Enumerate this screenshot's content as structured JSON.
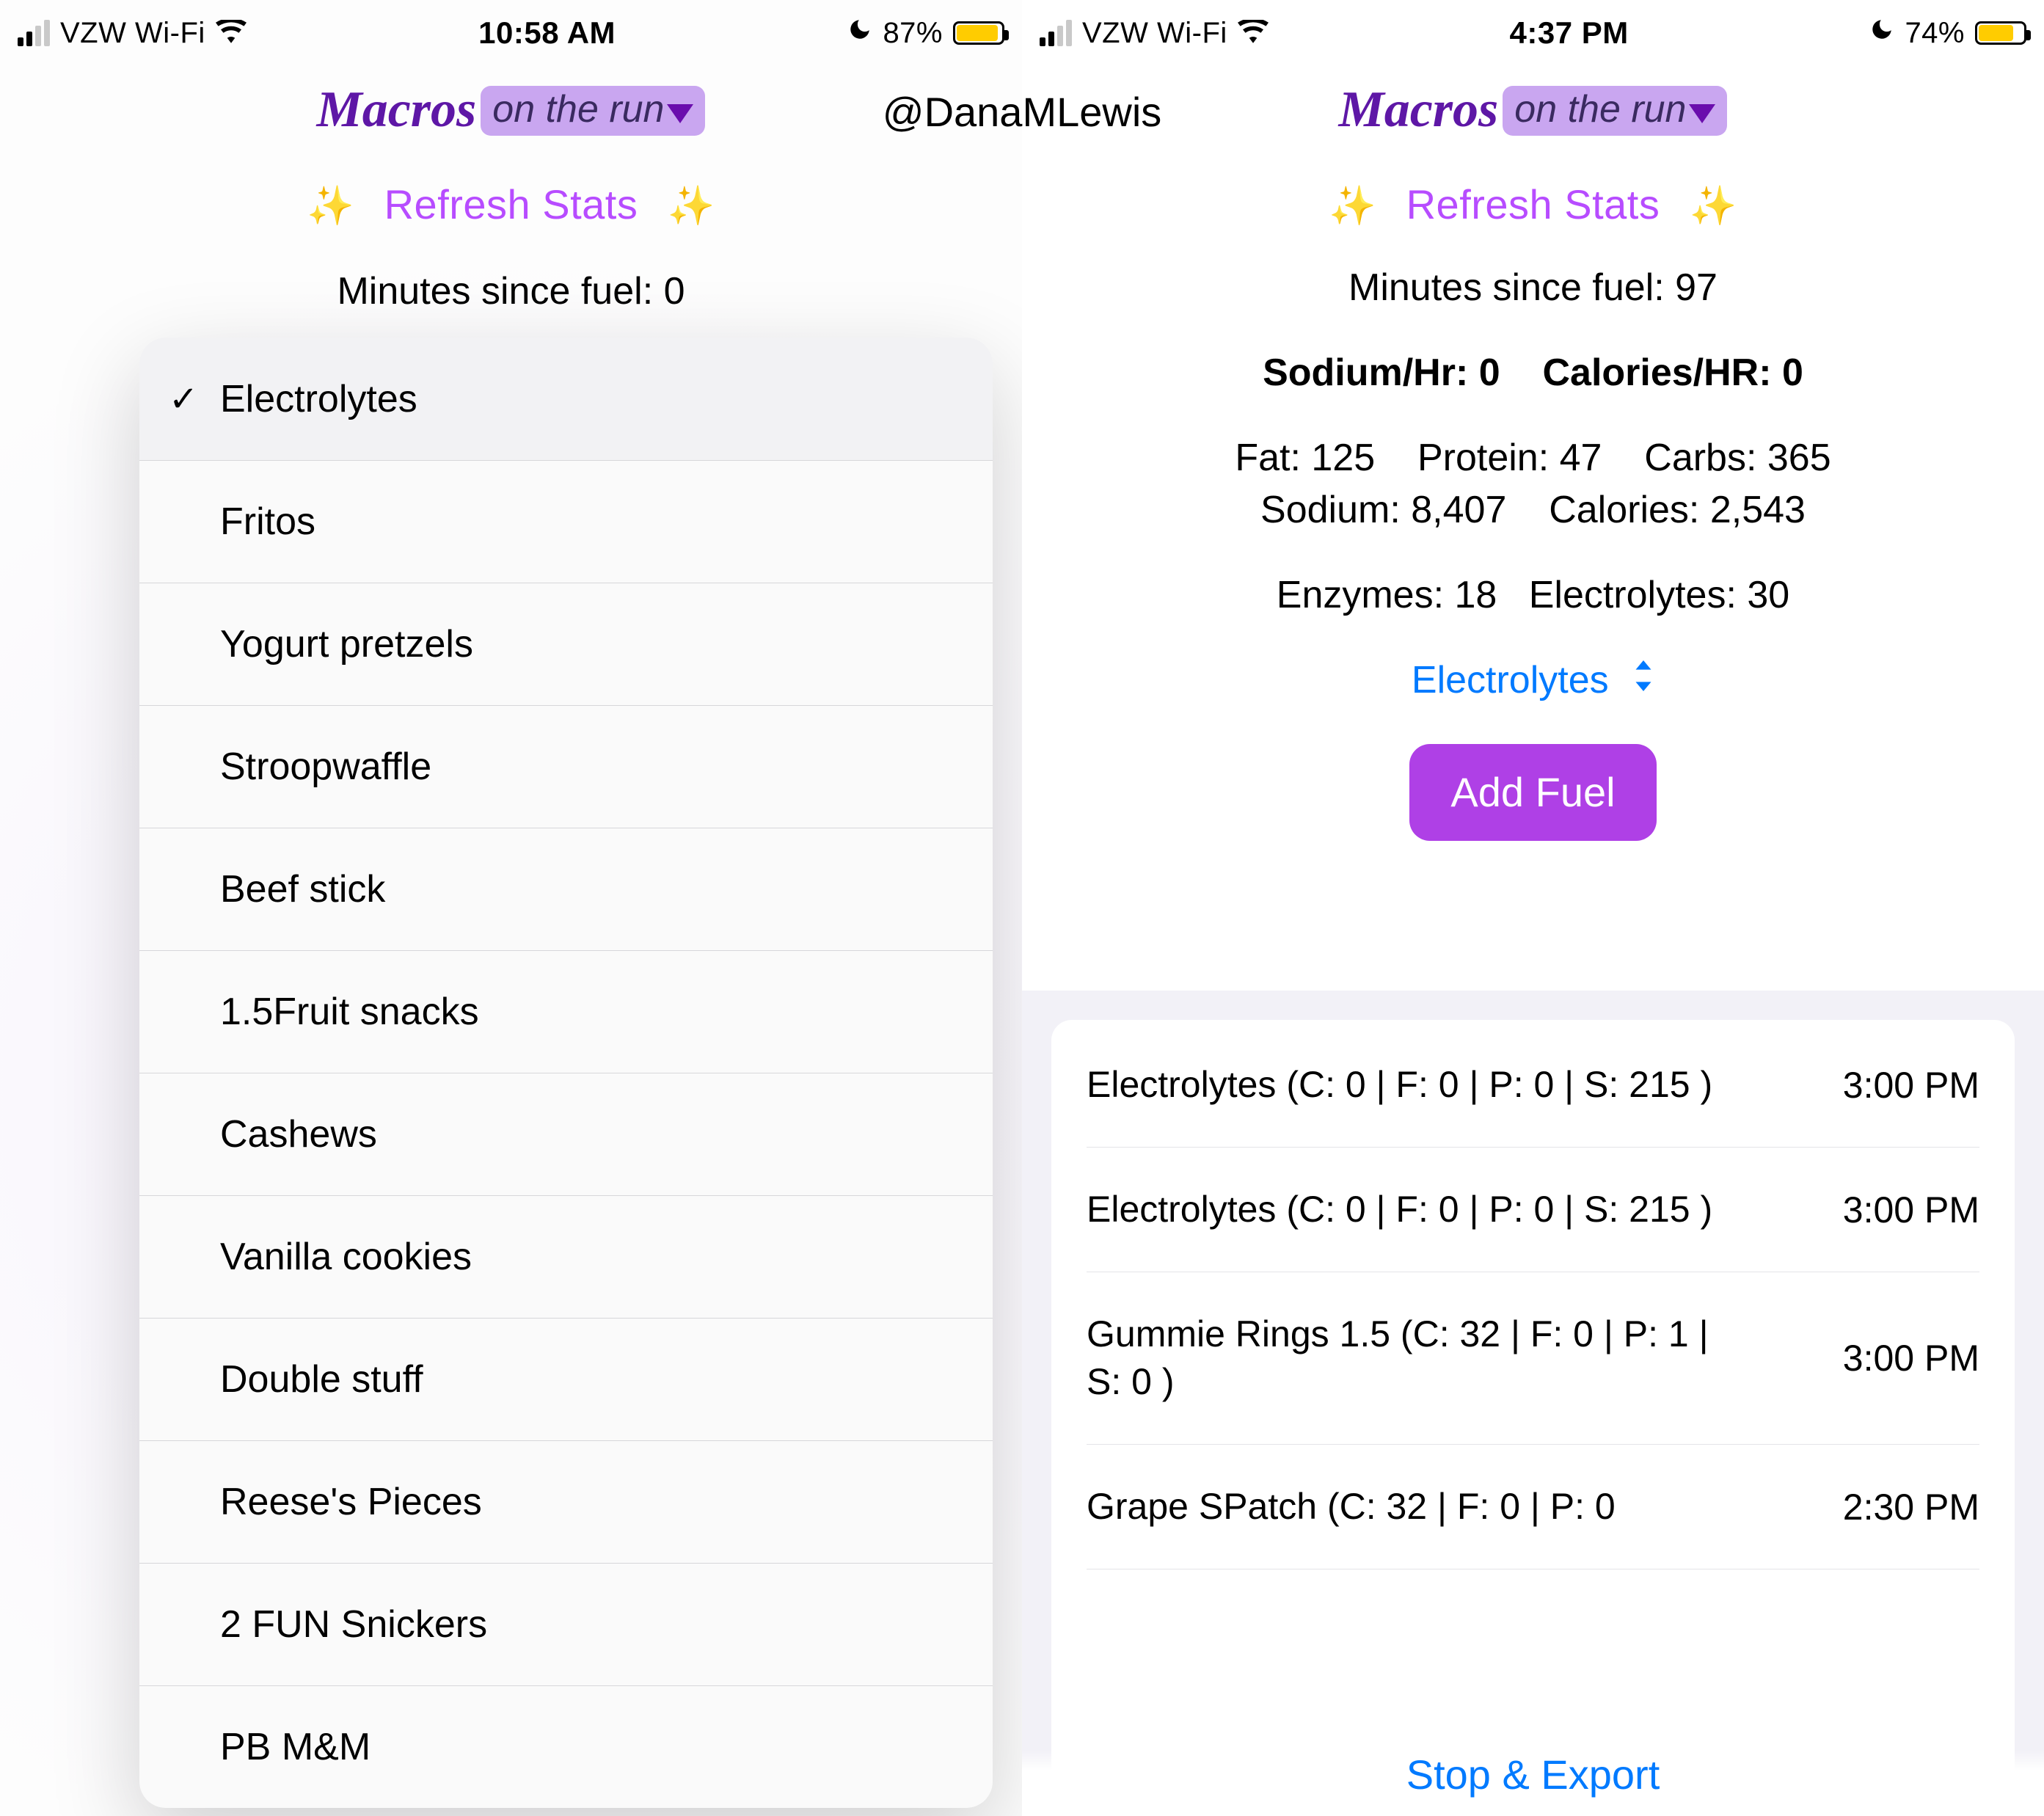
{
  "handle": "@DanaMLewis",
  "brand": {
    "name": "Macros",
    "tag": "on the run"
  },
  "refresh_label": "Refresh Stats",
  "left": {
    "statusbar": {
      "carrier": "VZW Wi-Fi",
      "time": "10:58 AM",
      "battery_pct": "87%",
      "battery_fill_pct": 87
    },
    "minutes_label": "Minutes since fuel:",
    "minutes_value": "0",
    "picker_selected_index": 0,
    "picker_items": [
      "Electrolytes",
      "Fritos",
      "Yogurt pretzels",
      "Stroopwaffle",
      "Beef stick",
      "1.5Fruit snacks",
      "Cashews",
      "Vanilla cookies",
      "Double stuff",
      "Reese's Pieces",
      "2 FUN Snickers",
      "PB M&M"
    ]
  },
  "right": {
    "statusbar": {
      "carrier": "VZW Wi-Fi",
      "time": "4:37 PM",
      "battery_pct": "74%",
      "battery_fill_pct": 74
    },
    "minutes_label": "Minutes since fuel:",
    "minutes_value": "97",
    "per_hour": {
      "sodium_label": "Sodium/Hr:",
      "sodium_value": "0",
      "calories_label": "Calories/HR:",
      "calories_value": "0"
    },
    "totals_line1": {
      "fat_label": "Fat:",
      "fat_value": "125",
      "protein_label": "Protein:",
      "protein_value": "47",
      "carbs_label": "Carbs:",
      "carbs_value": "365"
    },
    "totals_line2": {
      "sodium_label": "Sodium:",
      "sodium_value": "8,407",
      "calories_label": "Calories:",
      "calories_value": "2,543"
    },
    "totals_line3": {
      "enzymes_label": "Enzymes:",
      "enzymes_value": "18",
      "electrolytes_label": "Electrolytes:",
      "electrolytes_value": "30"
    },
    "fuel_select_value": "Electrolytes",
    "add_fuel_label": "Add Fuel",
    "history": [
      {
        "desc": "Electrolytes (C: 0 | F: 0 | P: 0 | S: 215 )",
        "time": "3:00 PM"
      },
      {
        "desc": "Electrolytes (C: 0 | F: 0 | P: 0 | S: 215 )",
        "time": "3:00 PM"
      },
      {
        "desc": "Gummie Rings 1.5 (C: 32 | F: 0 | P: 1 | S: 0 )",
        "time": "3:00 PM"
      },
      {
        "desc": "Grape SPatch (C: 32 | F: 0 | P: 0",
        "time": "2:30 PM"
      }
    ],
    "stop_export_label": "Stop & Export"
  }
}
